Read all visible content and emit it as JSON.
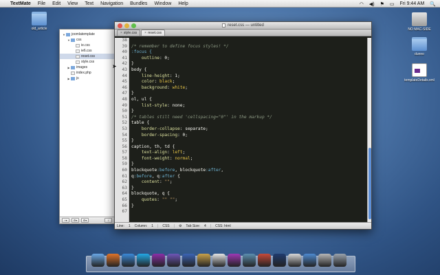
{
  "menubar": {
    "apple": "",
    "items": [
      "TextMate",
      "File",
      "Edit",
      "View",
      "Text",
      "Navigation",
      "Bundles",
      "Window",
      "Help"
    ],
    "clock": "Fri 9:44 AM",
    "spotlight": "🔍"
  },
  "desktop": {
    "icons": [
      {
        "label": "old_article",
        "kind": "folder"
      },
      {
        "label": "NO MAC-SIDE",
        "kind": "drive"
      },
      {
        "label": "dunno",
        "kind": "folder"
      },
      {
        "label": "templateDetails.xml",
        "kind": "doc"
      }
    ]
  },
  "drawer": {
    "tree": [
      {
        "label": "joomlatemplate",
        "depth": 0,
        "type": "folder",
        "expanded": true
      },
      {
        "label": "css",
        "depth": 1,
        "type": "folder",
        "expanded": true
      },
      {
        "label": "ie.css",
        "depth": 2,
        "type": "file"
      },
      {
        "label": "ie6.css",
        "depth": 2,
        "type": "file"
      },
      {
        "label": "reset.css",
        "depth": 2,
        "type": "file",
        "selected": true
      },
      {
        "label": "style.css",
        "depth": 2,
        "type": "file"
      },
      {
        "label": "images",
        "depth": 1,
        "type": "folder",
        "expanded": false
      },
      {
        "label": "index.php",
        "depth": 1,
        "type": "file"
      },
      {
        "label": "js",
        "depth": 1,
        "type": "folder",
        "expanded": false
      }
    ],
    "footer": {
      "add": "+▾",
      "action": "⚙▾",
      "gear": "⚙▾",
      "info": "i"
    }
  },
  "window": {
    "title": "reset.css — untitled",
    "tabs": [
      {
        "label": "style.css",
        "active": false
      },
      {
        "label": "reset.css",
        "active": true
      }
    ]
  },
  "editor": {
    "line_numbers": [
      "38",
      "39",
      "40",
      "41",
      "42",
      "43",
      "44",
      "45",
      "46",
      "47",
      "48",
      "49",
      "50",
      "51",
      "52",
      "53",
      "54",
      "55",
      "56",
      "57",
      "58",
      "59",
      "60",
      "61",
      "62",
      "63",
      "64",
      "65",
      "66",
      "67"
    ],
    "lines": [
      [],
      [
        {
          "t": "/* remember to define focus styles! */",
          "c": "comment"
        }
      ],
      [
        {
          "t": ":focus {",
          "c": "pseudo"
        }
      ],
      [
        {
          "t": "    outline",
          "c": "prop"
        },
        {
          "t": ": 0;",
          "c": "selector"
        }
      ],
      [
        {
          "t": "}",
          "c": "selector"
        }
      ],
      [
        {
          "t": "body {",
          "c": "selector"
        }
      ],
      [
        {
          "t": "    line-height",
          "c": "prop"
        },
        {
          "t": ": 1;",
          "c": "selector"
        }
      ],
      [
        {
          "t": "    color",
          "c": "prop"
        },
        {
          "t": ": ",
          "c": "selector"
        },
        {
          "t": "black",
          "c": "val"
        },
        {
          "t": ";",
          "c": "selector"
        }
      ],
      [
        {
          "t": "    background",
          "c": "prop"
        },
        {
          "t": ": ",
          "c": "selector"
        },
        {
          "t": "white",
          "c": "val"
        },
        {
          "t": ";",
          "c": "selector"
        }
      ],
      [
        {
          "t": "}",
          "c": "selector"
        }
      ],
      [
        {
          "t": "ol, ul {",
          "c": "selector"
        }
      ],
      [
        {
          "t": "    list-style",
          "c": "prop"
        },
        {
          "t": ": none;",
          "c": "selector"
        }
      ],
      [
        {
          "t": "}",
          "c": "selector"
        }
      ],
      [
        {
          "t": "/* tables still need 'cellspacing=\"0\"' in the markup */",
          "c": "comment"
        }
      ],
      [
        {
          "t": "table {",
          "c": "selector"
        }
      ],
      [
        {
          "t": "    border-collapse",
          "c": "prop"
        },
        {
          "t": ": separate;",
          "c": "selector"
        }
      ],
      [
        {
          "t": "    border-spacing",
          "c": "prop"
        },
        {
          "t": ": 0;",
          "c": "selector"
        }
      ],
      [
        {
          "t": "}",
          "c": "selector"
        }
      ],
      [
        {
          "t": "caption, th, td {",
          "c": "selector"
        }
      ],
      [
        {
          "t": "    text-align",
          "c": "prop"
        },
        {
          "t": ": ",
          "c": "selector"
        },
        {
          "t": "left",
          "c": "val"
        },
        {
          "t": ";",
          "c": "selector"
        }
      ],
      [
        {
          "t": "    font-weight",
          "c": "prop"
        },
        {
          "t": ": ",
          "c": "selector"
        },
        {
          "t": "normal",
          "c": "val"
        },
        {
          "t": ";",
          "c": "selector"
        }
      ],
      [
        {
          "t": "}",
          "c": "selector"
        }
      ],
      [
        {
          "t": "blockquote",
          "c": "selector"
        },
        {
          "t": ":before",
          "c": "pseudo"
        },
        {
          "t": ", blockquote",
          "c": "selector"
        },
        {
          "t": ":after",
          "c": "pseudo"
        },
        {
          "t": ",",
          "c": "selector"
        }
      ],
      [
        {
          "t": "q",
          "c": "selector"
        },
        {
          "t": ":before",
          "c": "pseudo"
        },
        {
          "t": ", q",
          "c": "selector"
        },
        {
          "t": ":after",
          "c": "pseudo"
        },
        {
          "t": " {",
          "c": "selector"
        }
      ],
      [
        {
          "t": "    content",
          "c": "prop"
        },
        {
          "t": ": ",
          "c": "selector"
        },
        {
          "t": "\"\"",
          "c": "str"
        },
        {
          "t": ";",
          "c": "selector"
        }
      ],
      [
        {
          "t": "}",
          "c": "selector"
        }
      ],
      [
        {
          "t": "blockquote, q {",
          "c": "selector"
        }
      ],
      [
        {
          "t": "    quotes",
          "c": "prop"
        },
        {
          "t": ": ",
          "c": "selector"
        },
        {
          "t": "\"\" \"\"",
          "c": "str"
        },
        {
          "t": ";",
          "c": "selector"
        }
      ],
      [
        {
          "t": "}",
          "c": "selector"
        }
      ],
      []
    ]
  },
  "statusbar": {
    "line_label": "Line:",
    "line_value": "1",
    "column_label": "Column:",
    "column_value": "1",
    "language": "CSS",
    "tab_size_label": "Tab Size:",
    "tab_size_value": "4",
    "symbol": "CSS: html"
  },
  "dock": {
    "icons": [
      {
        "name": "finder-icon",
        "color": "#6aa7e6"
      },
      {
        "name": "firefox-icon",
        "color": "#e0742a"
      },
      {
        "name": "safari-icon",
        "color": "#3b8ad9"
      },
      {
        "name": "skype-icon",
        "color": "#23a9e6"
      },
      {
        "name": "textmate-icon",
        "color": "#8b2fa8"
      },
      {
        "name": "omnifocus-icon",
        "color": "#6e56b8"
      },
      {
        "name": "todo-icon",
        "color": "#3c64b6"
      },
      {
        "name": "notes-icon",
        "color": "#c9a24b"
      },
      {
        "name": "ical-icon",
        "color": "#e6e6e6"
      },
      {
        "name": "textmate2-icon",
        "color": "#9e39b5"
      },
      {
        "name": "coda-icon",
        "color": "#5b8fb0"
      },
      {
        "name": "transmit-icon",
        "color": "#c74a3a"
      },
      {
        "name": "photoshop-icon",
        "color": "#1f3b6e"
      },
      {
        "name": "preview-icon",
        "color": "#d9d9d9"
      },
      {
        "name": "iphoto-icon",
        "color": "#4e8bd1"
      },
      {
        "name": "downloads-icon",
        "color": "#b7b7b7"
      },
      {
        "name": "trash-icon",
        "color": "#9aa3ae"
      }
    ]
  },
  "colors": {
    "editor_bg": "#1d1f1a",
    "comment": "#8d9a84",
    "property": "#dfe4a0",
    "value": "#e7c547",
    "pseudo": "#6fb3d2"
  }
}
